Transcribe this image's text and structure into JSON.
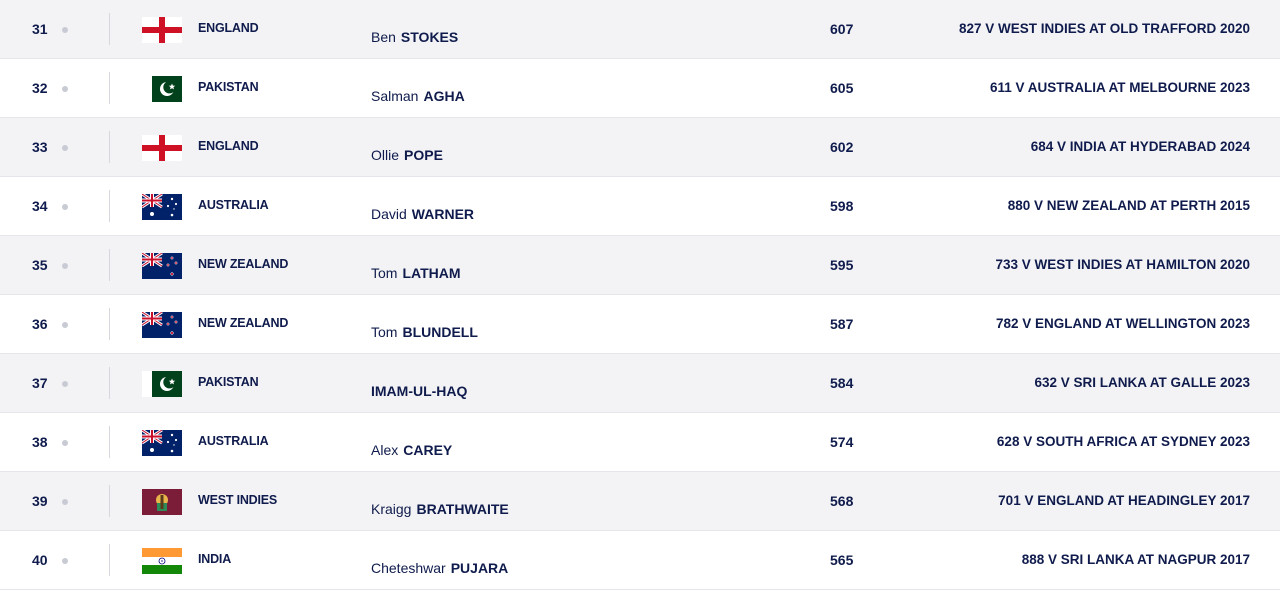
{
  "rankings": [
    {
      "position": "31",
      "country": "ENGLAND",
      "flag": "england",
      "first_name": "Ben",
      "last_name": "STOKES",
      "rating": "607",
      "best": "827 V WEST INDIES AT OLD TRAFFORD 2020"
    },
    {
      "position": "32",
      "country": "PAKISTAN",
      "flag": "pakistan",
      "first_name": "Salman",
      "last_name": "AGHA",
      "rating": "605",
      "best": "611 V AUSTRALIA AT MELBOURNE 2023"
    },
    {
      "position": "33",
      "country": "ENGLAND",
      "flag": "england",
      "first_name": "Ollie",
      "last_name": "POPE",
      "rating": "602",
      "best": "684 V INDIA AT HYDERABAD 2024"
    },
    {
      "position": "34",
      "country": "AUSTRALIA",
      "flag": "australia",
      "first_name": "David",
      "last_name": "WARNER",
      "rating": "598",
      "best": "880 V NEW ZEALAND AT PERTH 2015"
    },
    {
      "position": "35",
      "country": "NEW ZEALAND",
      "flag": "new-zealand",
      "first_name": "Tom",
      "last_name": "LATHAM",
      "rating": "595",
      "best": "733 V WEST INDIES AT HAMILTON 2020"
    },
    {
      "position": "36",
      "country": "NEW ZEALAND",
      "flag": "new-zealand",
      "first_name": "Tom",
      "last_name": "BLUNDELL",
      "rating": "587",
      "best": "782 V ENGLAND AT WELLINGTON 2023"
    },
    {
      "position": "37",
      "country": "PAKISTAN",
      "flag": "pakistan",
      "first_name": "",
      "last_name": "IMAM-UL-HAQ",
      "rating": "584",
      "best": "632 V SRI LANKA AT GALLE 2023"
    },
    {
      "position": "38",
      "country": "AUSTRALIA",
      "flag": "australia",
      "first_name": "Alex",
      "last_name": "CAREY",
      "rating": "574",
      "best": "628 V SOUTH AFRICA AT SYDNEY 2023"
    },
    {
      "position": "39",
      "country": "WEST INDIES",
      "flag": "west-indies",
      "first_name": "Kraigg",
      "last_name": "BRATHWAITE",
      "rating": "568",
      "best": "701 V ENGLAND AT HEADINGLEY 2017"
    },
    {
      "position": "40",
      "country": "INDIA",
      "flag": "india",
      "first_name": "Cheteshwar",
      "last_name": "PUJARA",
      "rating": "565",
      "best": "888 V SRI LANKA AT NAGPUR 2017"
    }
  ],
  "colors": {
    "text": "#0f1b4c",
    "row_alt": "#f3f3f5",
    "dot": "#c9cbd4"
  }
}
